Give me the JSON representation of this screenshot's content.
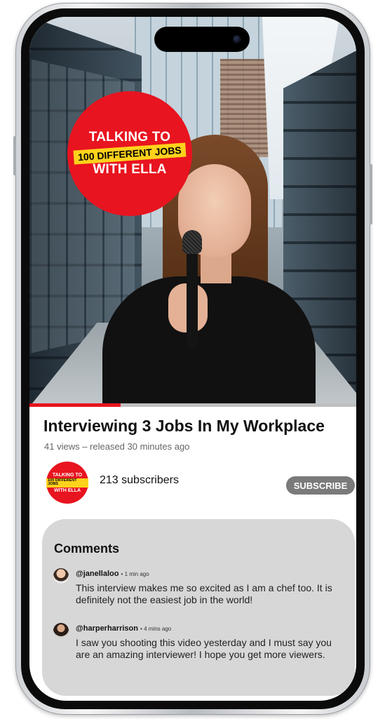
{
  "thumbnail": {
    "logo_line1": "TALKING TO",
    "logo_line2": "100 DIFFERENT JOBS",
    "logo_line3": "WITH ELLA",
    "progress_fraction": 0.27
  },
  "video": {
    "title": "Interviewing 3 Jobs In My Workplace",
    "meta": "41 views – released 30 minutes ago"
  },
  "channel": {
    "avatar_line1": "TALKING TO",
    "avatar_line2": "100 DIFFERENT JOBS",
    "avatar_line3": "WITH ELLA",
    "subscribers": "213 subscribers",
    "subscribe_label": "SUBSCRIBE"
  },
  "comments": {
    "title": "Comments",
    "items": [
      {
        "user": "@janellaloo",
        "time": "1 min ago",
        "text": "This interview makes me so excited as I am a chef too. It is definitely not the easiest job in the world!"
      },
      {
        "user": "@harperharrison",
        "time": "4 mins ago",
        "text": "I saw you shooting this video yesterday and I must say you are an amazing interviewer! I hope you get more viewers."
      }
    ]
  },
  "colors": {
    "accent_red": "#e8141f",
    "logo_yellow": "#ffd21c",
    "subscribe_gray": "#7a7a7a",
    "comments_bg": "#d7d7d7"
  }
}
